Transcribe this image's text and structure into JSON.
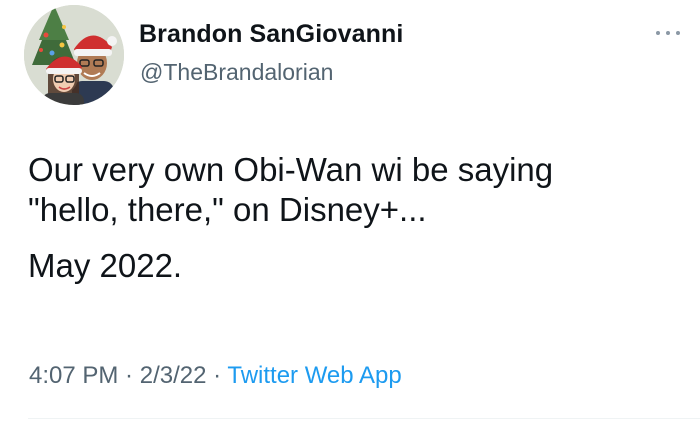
{
  "author": {
    "display_name": "Brandon SanGiovanni",
    "handle": "@TheBrandalorian",
    "avatar_icon": "profile-photo"
  },
  "more_icon": "more-horizontal-icon",
  "tweet": {
    "lines": [
      "Our very own Obi-Wan wi be saying",
      "\"hello, there,\" on Disney+...",
      "May 2022."
    ]
  },
  "meta": {
    "time": "4:07 PM",
    "sep1": " · ",
    "date": "2/3/22",
    "sep2": " · ",
    "source": "Twitter Web App"
  },
  "colors": {
    "text": "#0f1419",
    "secondary": "#536471",
    "link": "#1d9bf0"
  }
}
